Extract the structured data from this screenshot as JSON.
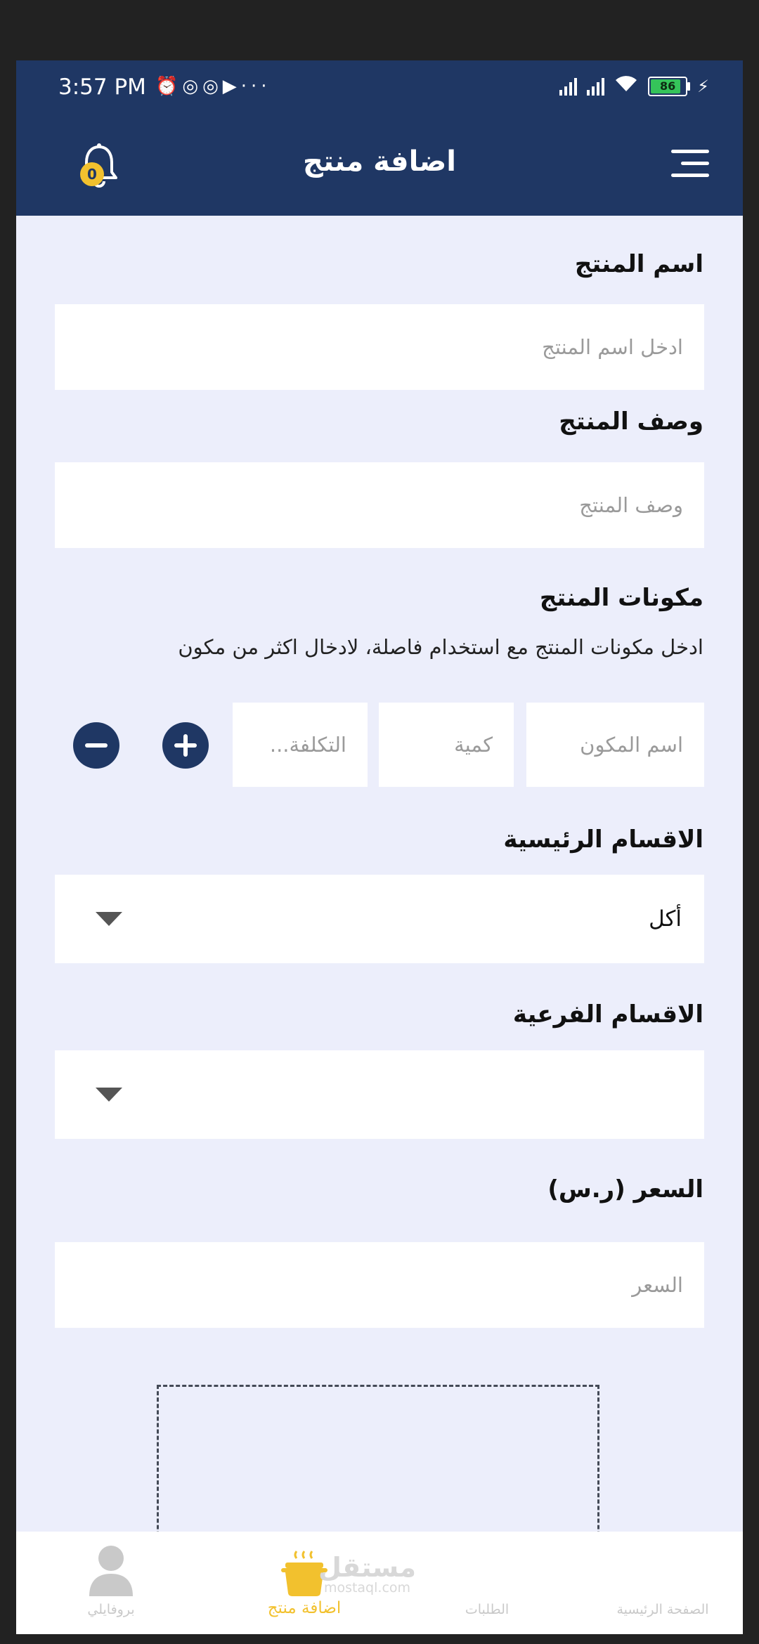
{
  "status_bar": {
    "time": "3:57 PM",
    "battery_level": "86",
    "icons": [
      "alarm-icon",
      "notification-icon",
      "notification-icon",
      "youtube-icon",
      "more-icon",
      "signal-icon",
      "signal-icon",
      "wifi-icon",
      "battery-icon",
      "charging-icon"
    ]
  },
  "app_bar": {
    "title": "اضافة منتج",
    "notification_count": "0",
    "icons": [
      "menu-icon",
      "bell-icon"
    ]
  },
  "form": {
    "product_name": {
      "label": "اسم المنتج",
      "placeholder": "ادخل اسم المنتج"
    },
    "product_description": {
      "label": "وصف المنتج",
      "placeholder": "وصف المنتج"
    },
    "ingredients": {
      "label": "مكونات المنتج",
      "hint": "ادخل مكونات المنتج مع استخدام فاصلة، لادخال اكثر من مكون",
      "name_placeholder": "اسم المكون",
      "quantity_placeholder": "كمية",
      "cost_placeholder": "التكلفة..."
    },
    "main_category": {
      "label": "الاقسام الرئيسية",
      "value": "أكل"
    },
    "sub_category": {
      "label": "الاقسام الفرعية",
      "value": ""
    },
    "price": {
      "label": "السعر (ر.س)",
      "placeholder": "السعر"
    }
  },
  "bottom_nav": {
    "items": [
      {
        "label": "بروفايلي",
        "icon": "user-icon",
        "active": false
      },
      {
        "label": "اضافة منتج",
        "icon": "cooking-pot-icon",
        "active": true
      },
      {
        "label": "الطلبات",
        "icon": "orders-icon",
        "active": false
      },
      {
        "label": "الصفحة الرئيسية",
        "icon": "home-icon",
        "active": false
      }
    ]
  },
  "watermark": {
    "name": "مستقل",
    "url": "mostaql.com"
  },
  "colors": {
    "primary": "#1F3764",
    "accent": "#F2C12E",
    "background": "#ECEEFB",
    "field": "#FFFFFF"
  }
}
